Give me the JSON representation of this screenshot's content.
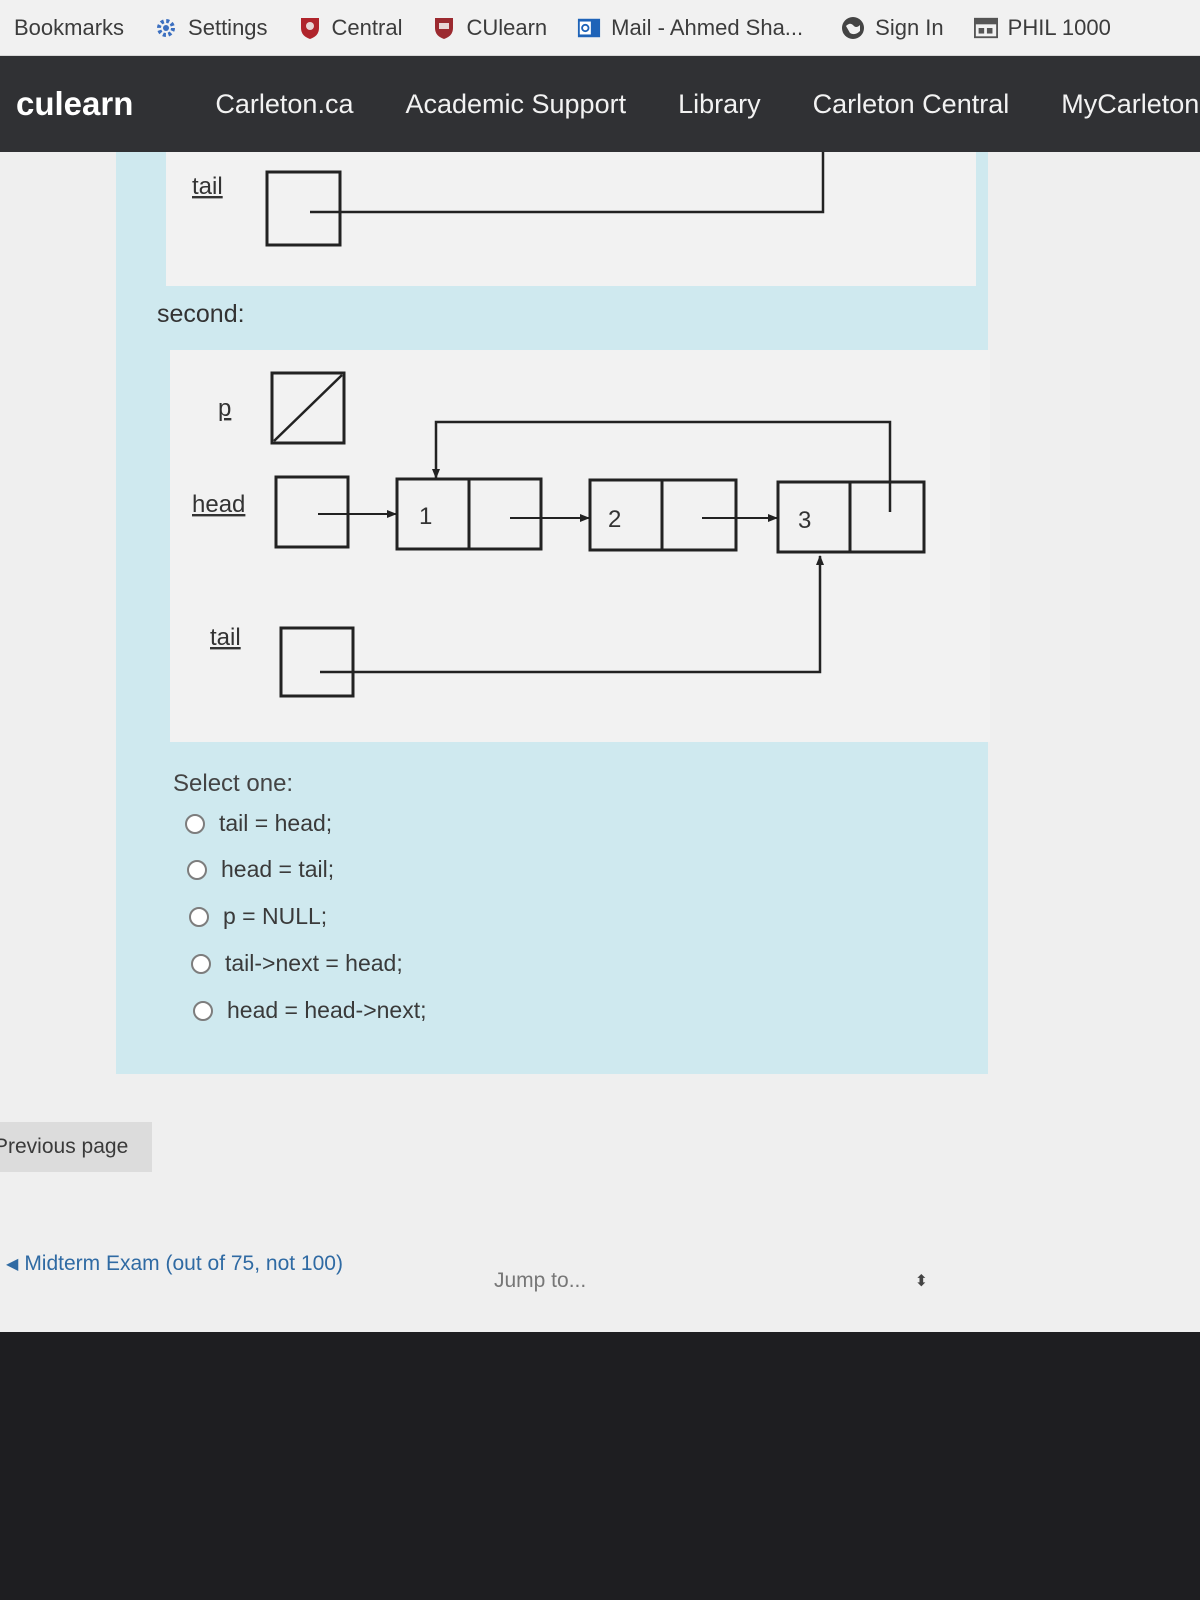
{
  "bookmarks": [
    {
      "label": "Bookmarks",
      "icon": "none"
    },
    {
      "label": "Settings",
      "icon": "gear-icon"
    },
    {
      "label": "Central",
      "icon": "crest-icon"
    },
    {
      "label": "CUlearn",
      "icon": "crest-icon"
    },
    {
      "label": "Mail - Ahmed Sha...",
      "icon": "outlook-icon"
    },
    {
      "label": "Sign In",
      "icon": "globe-icon"
    },
    {
      "label": "PHIL 1000",
      "icon": "window-icon"
    }
  ],
  "nav": {
    "brand": "culearn",
    "links": [
      "Carleton.ca",
      "Academic Support",
      "Library",
      "Carleton Central",
      "MyCarleton"
    ]
  },
  "question": {
    "top_label_tail": "tail",
    "second_label": "second:",
    "diagram_labels": {
      "p": "p",
      "head": "head",
      "tail": "tail"
    },
    "nodes": [
      "1",
      "2",
      "3"
    ],
    "select_one": "Select one:",
    "options": [
      "tail = head;",
      "head = tail;",
      "p = NULL;",
      "tail->next = head;",
      "head = head->next;"
    ]
  },
  "footer": {
    "previous_page": "Previous page",
    "quiz_link": "Midterm Exam (out of 75, not 100)",
    "jump_to": "Jump to..."
  },
  "colors": {
    "accent_bg": "#cfe9ef",
    "nav_bg": "#303134",
    "link": "#2f6aa3"
  }
}
